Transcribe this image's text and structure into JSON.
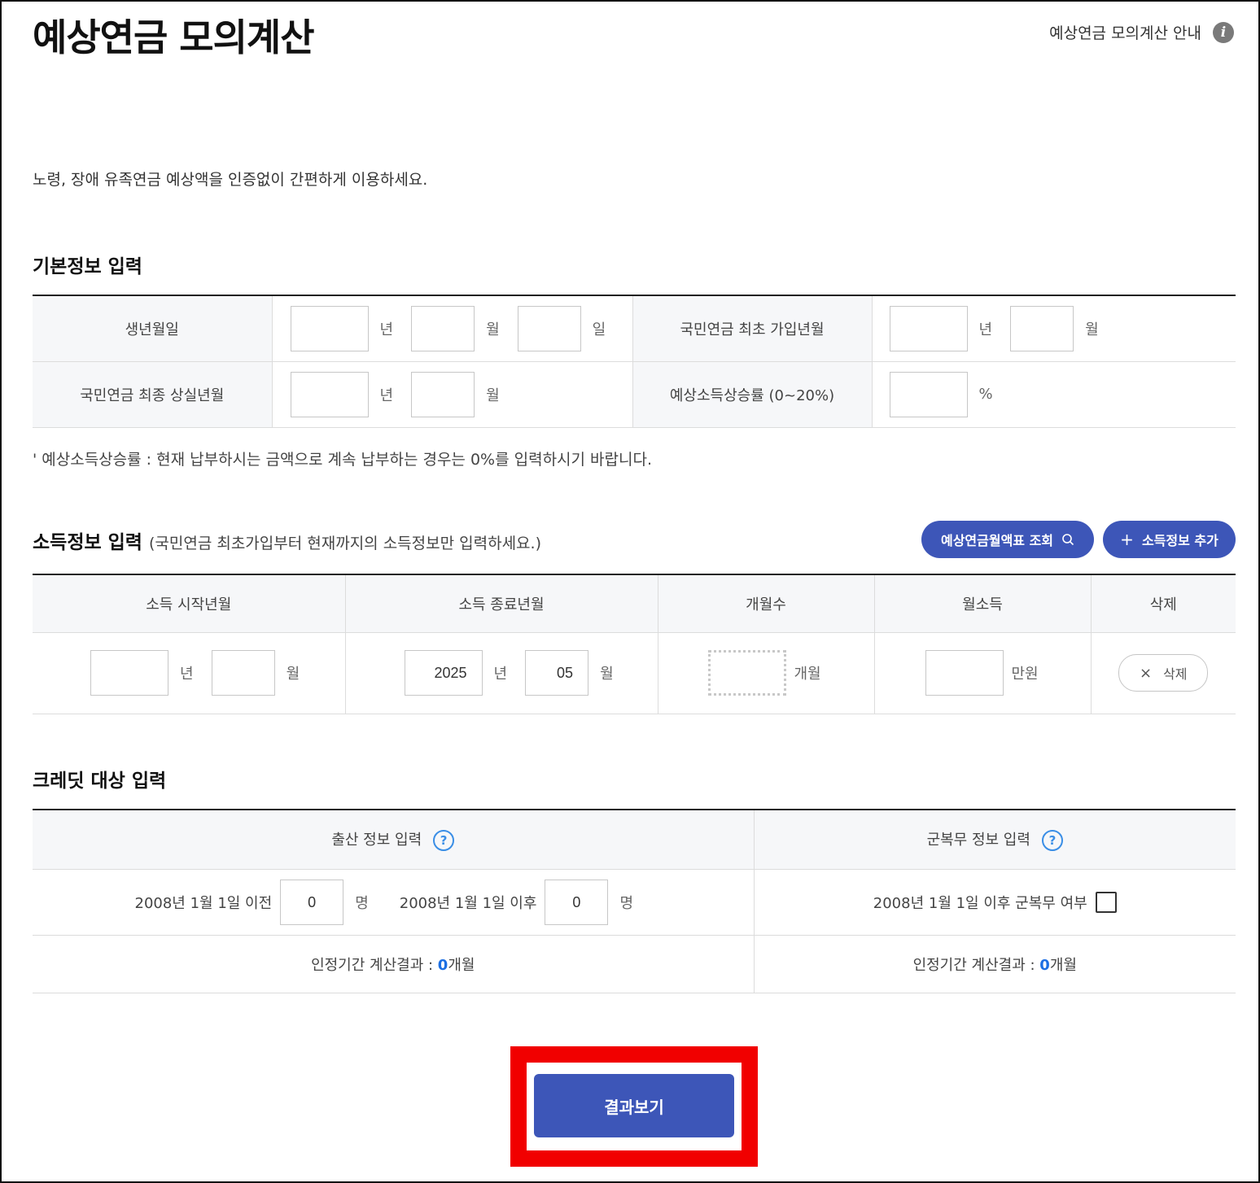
{
  "page": {
    "title": "예상연금 모의계산",
    "guide_label": "예상연금 모의계산 안내",
    "info_icon_glyph": "i",
    "intro": "노령, 장애 유족연금 예상액을 인증없이 간편하게 이용하세요."
  },
  "basic": {
    "section_title": "기본정보 입력",
    "birth_label": "생년월일",
    "first_join_label": "국민연금 최초 가입년월",
    "last_loss_label": "국민연금 최종 상실년월",
    "income_rate_label": "예상소득상승률 (0~20%)",
    "unit_year": "년",
    "unit_month": "월",
    "unit_day": "일",
    "unit_percent": "%",
    "note": "' 예상소득상승률 : 현재 납부하시는 금액으로 계속 납부하는 경우는 0%를 입력하시기 바랍니다."
  },
  "income": {
    "section_title": "소득정보 입력",
    "section_subtitle": "(국민연금 최초가입부터 현재까지의 소득정보만 입력하세요.)",
    "lookup_button": "예상연금월액표 조회",
    "add_button": "소득정보 추가",
    "headers": [
      "소득 시작년월",
      "소득 종료년월",
      "개월수",
      "월소득",
      "삭제"
    ],
    "row": {
      "start_year": "",
      "start_month": "",
      "end_year": "2025",
      "end_month": "05",
      "months": "",
      "monthly_income": ""
    },
    "unit_year": "년",
    "unit_month": "월",
    "unit_months": "개월",
    "unit_manwon": "만원",
    "delete_label": "삭제",
    "delete_glyph": "×",
    "add_glyph": "+",
    "search_glyph": "🔍"
  },
  "credit": {
    "section_title": "크레딧 대상 입력",
    "birth_info_label": "출산 정보 입력",
    "military_info_label": "군복무 정보 입력",
    "help_glyph": "?",
    "before_label": "2008년 1월 1일 이전",
    "before_value": "0",
    "after_label": "2008년 1월 1일 이후",
    "after_value": "0",
    "unit_person": "명",
    "military_label": "2008년 1월 1일 이후 군복무 여부",
    "military_checked": false,
    "result_prefix": "인정기간 계산결과 : ",
    "birth_result_value": "0",
    "military_result_value": "0",
    "result_unit": "개월"
  },
  "result_button": "결과보기",
  "colors": {
    "primary": "#3d56b8",
    "highlight": "#f10000",
    "help": "#3a8ee6",
    "result_value": "#1c6fe3"
  }
}
